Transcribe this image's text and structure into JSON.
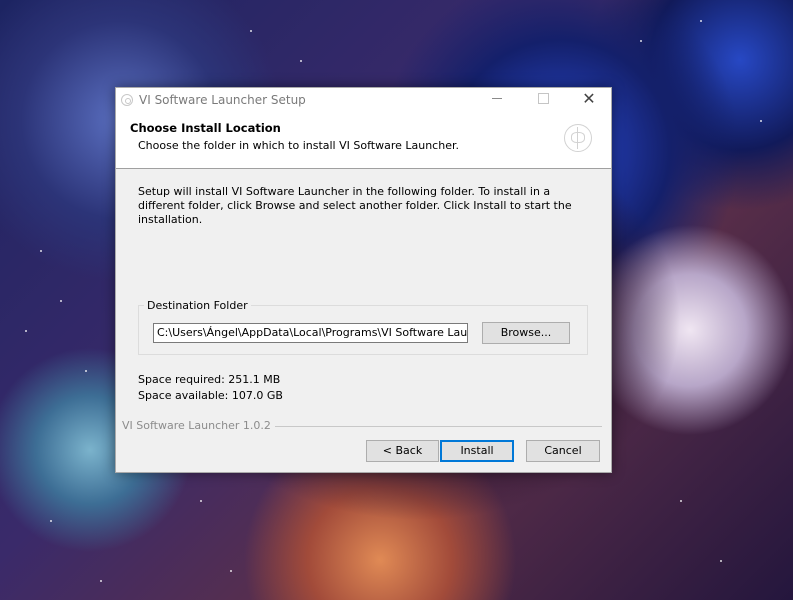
{
  "window": {
    "title": "VI Software Launcher Setup",
    "controls": {
      "minimize": "minimize",
      "maximize": "maximize",
      "close": "✕"
    }
  },
  "header": {
    "title": "Choose Install Location",
    "subtitle": "Choose the folder in which to install VI Software Launcher."
  },
  "body": {
    "intro": "Setup will install VI Software Launcher in the following folder. To install in a different folder, click Browse and select another folder. Click Install to start the installation.",
    "destination": {
      "legend": "Destination Folder",
      "path": "C:\\Users\\Ángel\\AppData\\Local\\Programs\\VI Software Launcher",
      "browse_label": "Browse..."
    },
    "space_required": "Space required: 251.1 MB",
    "space_available": "Space available: 107.0 GB"
  },
  "footer": {
    "brand": "VI Software Launcher 1.0.2",
    "back_label": "< Back",
    "install_label": "Install",
    "cancel_label": "Cancel"
  },
  "icons": {
    "app_icon": "app-logo-icon",
    "header_icon": "installer-logo-icon"
  },
  "colors": {
    "dialog_bg": "#f0f0f0",
    "header_bg": "#ffffff",
    "default_button_border": "#0078d7"
  }
}
